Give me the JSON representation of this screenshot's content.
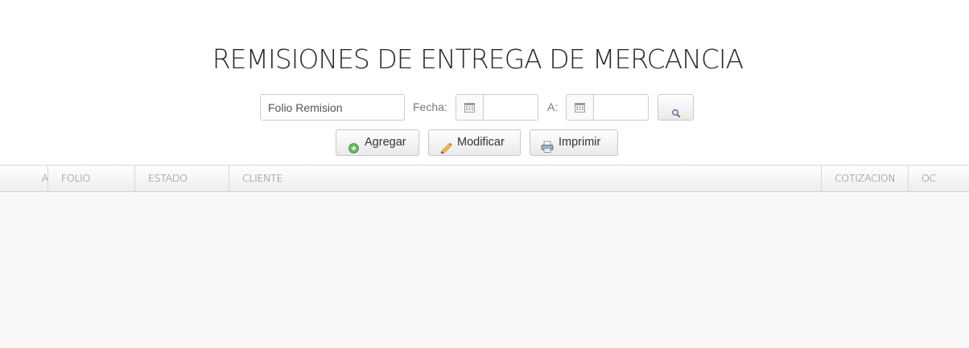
{
  "page": {
    "title": "REMISIONES DE ENTREGA DE MERCANCIA"
  },
  "search": {
    "folio_placeholder": "Folio Remision",
    "folio_value": "",
    "fecha_label": "Fecha:",
    "fecha_desde_value": "",
    "a_label": "A:",
    "fecha_hasta_value": "",
    "icons": {
      "calendar": "calendar-icon",
      "search": "magnifier-icon"
    }
  },
  "toolbar": {
    "agregar_label": "Agregar",
    "modificar_label": "Modificar",
    "imprimir_label": "Imprimir",
    "icons": {
      "agregar": "add-circle-icon",
      "modificar": "pencil-icon",
      "imprimir": "printer-icon"
    }
  },
  "table": {
    "columns": [
      "A",
      "FOLIO",
      "ESTADO",
      "CLIENTE",
      "COTIZACION",
      "OC"
    ],
    "rows": []
  },
  "colors": {
    "header_bg": "#ededed",
    "body_bg": "#f8f8f8",
    "add_icon_green": "#4caf50",
    "pencil_yellow": "#e8b93a"
  }
}
